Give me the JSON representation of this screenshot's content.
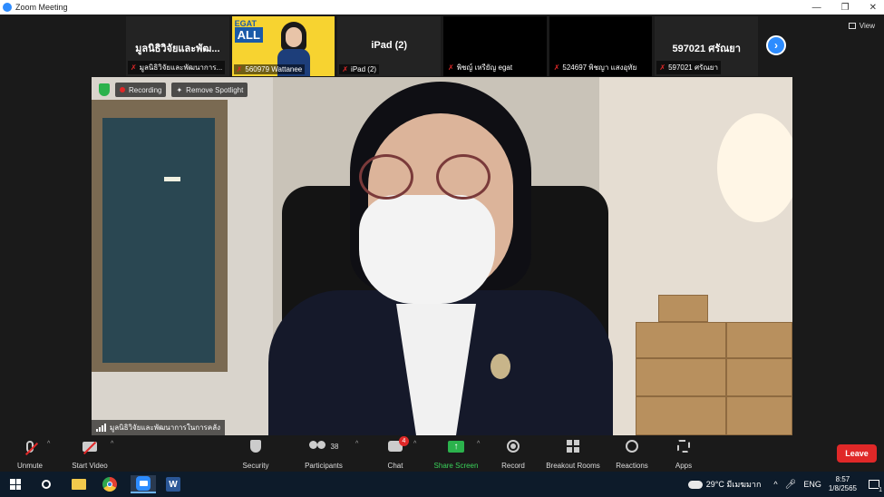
{
  "window": {
    "title": "Zoom Meeting",
    "controls": [
      "—",
      "❐",
      "✕"
    ]
  },
  "view": {
    "label": "View"
  },
  "strip": [
    {
      "name": "มูลนิธิวิจัยและพัฒ...",
      "label": "มูลนิธิวิจัยและพัฒนาการ...",
      "type": "name"
    },
    {
      "name": "",
      "label": "560979 Wattanee",
      "type": "image",
      "brand_top": "EGAT",
      "brand_main": "ALL"
    },
    {
      "name": "iPad (2)",
      "label": "iPad (2)",
      "type": "name"
    },
    {
      "name": "",
      "label": "พิชญ์ เหรียัญ egat",
      "type": "black"
    },
    {
      "name": "",
      "label": "524697 พิชญา แสงอุทัย",
      "type": "black"
    },
    {
      "name": "597021 ศรัณยา",
      "label": "597021 ศรัณยา",
      "type": "name"
    }
  ],
  "next_label": "›",
  "speaker": {
    "recording": "Recording",
    "remove_spotlight": "Remove Spotlight",
    "name": "มูลนิธิวิจัยและพัฒนาการในการคลัง"
  },
  "toolbar": {
    "unmute": "Unmute",
    "start_video": "Start Video",
    "security": "Security",
    "participants": "Participants",
    "participants_count": "38",
    "chat": "Chat",
    "chat_badge": "4",
    "share_screen": "Share Screen",
    "record": "Record",
    "breakout": "Breakout Rooms",
    "reactions": "Reactions",
    "apps": "Apps",
    "leave": "Leave"
  },
  "taskbar": {
    "word_letter": "W",
    "weather": "29°C มีเมฆมาก",
    "chevron": "^",
    "lang": "ENG",
    "time": "8:57",
    "date": "1/8/2565",
    "notifications": "1"
  },
  "colors": {
    "accent": "#2d8cff",
    "muted": "#e02828",
    "share": "#2bb24c",
    "leave": "#e02828"
  }
}
